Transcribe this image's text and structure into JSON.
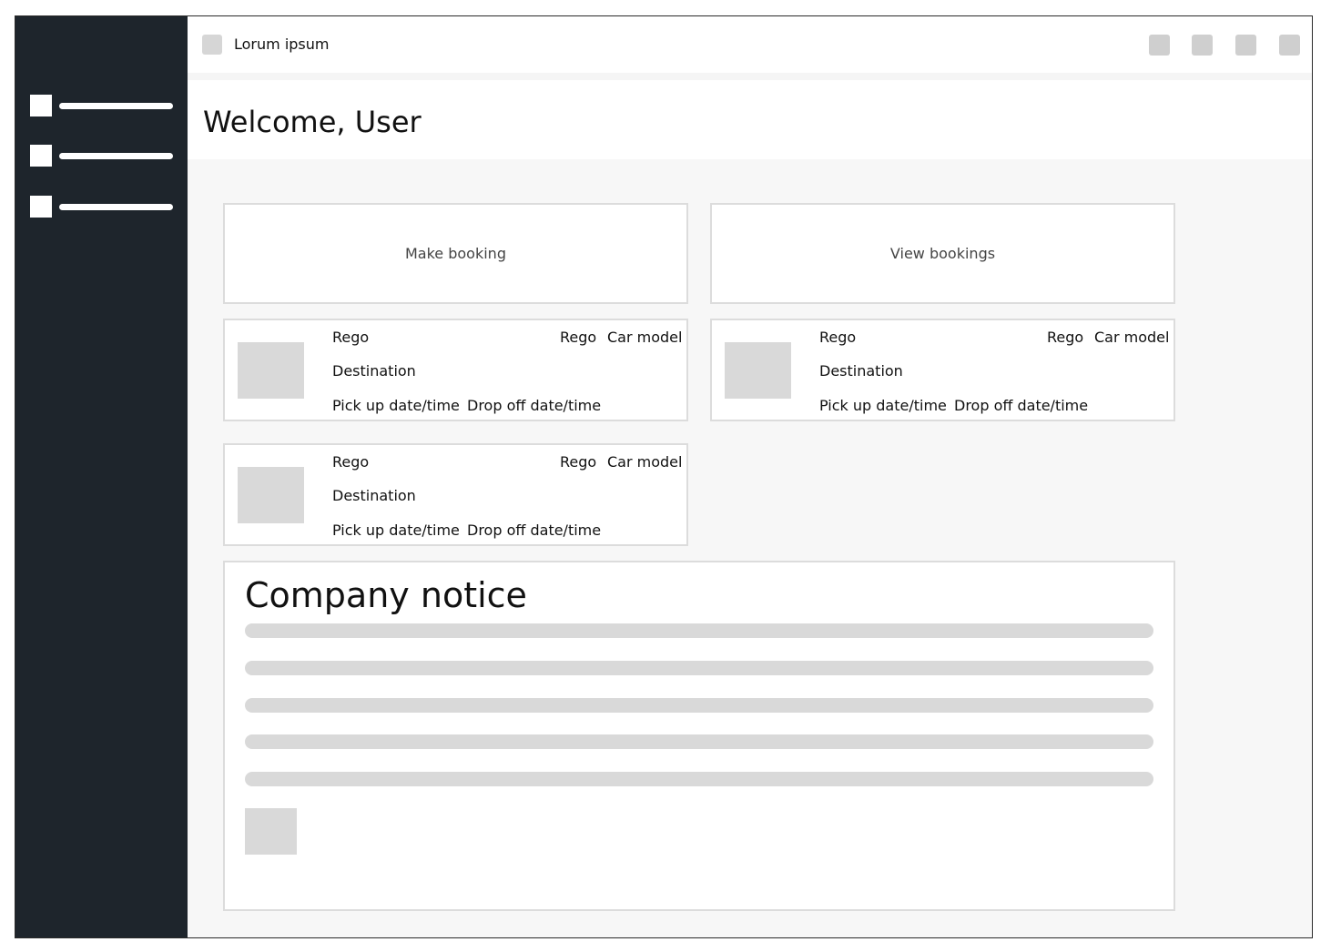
{
  "topbar": {
    "title": "Lorum ipsum",
    "icons": [
      "logo-icon",
      "action-icon-1",
      "action-icon-2",
      "action-icon-3",
      "action-icon-4"
    ]
  },
  "sidebar": {
    "items": [
      {
        "icon": "nav-icon-1"
      },
      {
        "icon": "nav-icon-2"
      },
      {
        "icon": "nav-icon-3"
      }
    ]
  },
  "header": {
    "welcome": "Welcome, User"
  },
  "actions": {
    "make_booking": "Make booking",
    "view_bookings": "View bookings"
  },
  "bookings": [
    {
      "rego_left": "Rego",
      "rego_right": "Rego",
      "car_model": "Car model",
      "destination": "Destination",
      "pickup": "Pick up date/time",
      "dropoff": "Drop off date/time"
    },
    {
      "rego_left": "Rego",
      "rego_right": "Rego",
      "car_model": "Car model",
      "destination": "Destination",
      "pickup": "Pick up date/time",
      "dropoff": "Drop off date/time"
    },
    {
      "rego_left": "Rego",
      "rego_right": "Rego",
      "car_model": "Car model",
      "destination": "Destination",
      "pickup": "Pick up date/time",
      "dropoff": "Drop off date/time"
    }
  ],
  "notice": {
    "title": "Company notice"
  },
  "colors": {
    "sidebar": "#1e252c",
    "placeholder": "#d9d9d9",
    "background": "#f7f7f7"
  }
}
